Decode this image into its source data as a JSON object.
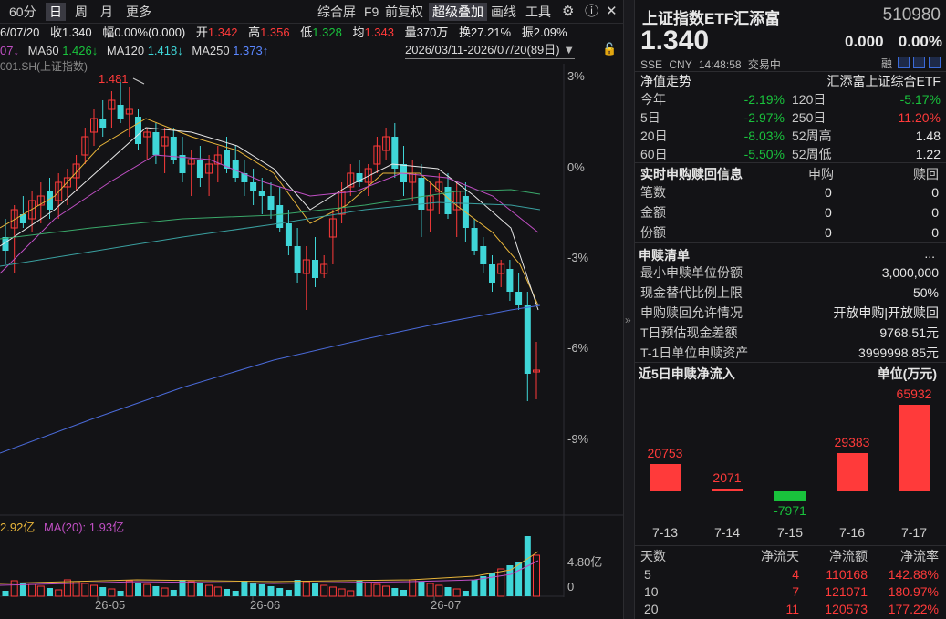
{
  "toolbar": {
    "items": [
      "60分",
      "日",
      "周",
      "月",
      "更多"
    ],
    "right_items": [
      "综合屏",
      "F9",
      "前复权",
      "超级叠加",
      "画线",
      "工具"
    ]
  },
  "info": {
    "date": "6/07/20",
    "close_label": "收",
    "close": "1.340",
    "change_label": "幅",
    "change": "0.00%(0.000)",
    "open_label": "开",
    "open": "1.342",
    "high_label": "高",
    "high": "1.356",
    "low_label": "低",
    "low": "1.328",
    "avg_label": "均",
    "avg": "1.343",
    "volume_label": "量",
    "volume": "370万",
    "turnover_label": "换",
    "turnover": "27.21%",
    "amplitude_label": "振",
    "amplitude": "2.09%"
  },
  "ma": {
    "ma30": "07↓",
    "ma60_label": "MA60",
    "ma60": "1.426↓",
    "ma120_label": "MA120",
    "ma120": "1.418↓",
    "ma250_label": "MA250",
    "ma250": "1.373↑"
  },
  "overlay_index": "001.SH(上证指数)",
  "date_range": "2026/03/11-2026/07/20(89日)",
  "peak_label": "1.481",
  "pct_axis": [
    "3%",
    "0%",
    "-3%",
    "-6%",
    "-9%"
  ],
  "volume_info": {
    "vol": "2.92亿",
    "ma20_label": "MA(20):",
    "ma20": "1.93亿",
    "scale_top": "4.80亿",
    "scale_zero": "0"
  },
  "x_axis": [
    "26-05",
    "26-06",
    "26-07"
  ],
  "quote": {
    "name": "上证指数ETF汇添富",
    "code": "510980",
    "price": "1.340",
    "change": "0.000",
    "change_pct": "0.00%",
    "exchange": "SSE",
    "currency": "CNY",
    "time": "14:48:58",
    "status": "交易中",
    "margin_tag": "融"
  },
  "nav_trend": {
    "title": "净值走势",
    "fund_name": "汇添富上证综合ETF",
    "rows": [
      {
        "l1": "今年",
        "v1": "-2.19%",
        "l2": "120日",
        "v2": "-5.17%"
      },
      {
        "l1": "5日",
        "v1": "-2.97%",
        "l2": "250日",
        "v2": "11.20%"
      },
      {
        "l1": "20日",
        "v1": "-8.03%",
        "l2": "52周高",
        "v2": "1.48"
      },
      {
        "l1": "60日",
        "v1": "-5.50%",
        "l2": "52周低",
        "v2": "1.22"
      }
    ]
  },
  "realtime": {
    "title": "实时申购赎回信息",
    "col1": "申购",
    "col2": "赎回",
    "rows": [
      {
        "label": "笔数",
        "sub": "0",
        "red": "0"
      },
      {
        "label": "金额",
        "sub": "0",
        "red": "0"
      },
      {
        "label": "份额",
        "sub": "0",
        "red": "0"
      }
    ]
  },
  "list": {
    "title": "申赎清单",
    "more": "...",
    "rows": [
      {
        "label": "最小申赎单位份额",
        "value": "3,000,000"
      },
      {
        "label": "现金替代比例上限",
        "value": "50%"
      },
      {
        "label": "申购赎回允许情况",
        "value": "开放申购|开放赎回"
      },
      {
        "label": "T日预估现金差额",
        "value": "9768.51元"
      },
      {
        "label": "T-1日单位申赎资产",
        "value": "3999998.85元"
      }
    ]
  },
  "flow": {
    "title": "近5日申赎净流入",
    "unit": "单位(万元)",
    "dates": [
      "7-13",
      "7-14",
      "7-15",
      "7-16",
      "7-17"
    ],
    "values": [
      20753,
      2071,
      -7971,
      29383,
      65932
    ]
  },
  "flow_table": {
    "headers": [
      "天数",
      "净流天",
      "净流额",
      "净流率"
    ],
    "rows": [
      {
        "days": "5",
        "flow_days": "4",
        "amount": "110168",
        "rate": "142.88%"
      },
      {
        "days": "10",
        "flow_days": "7",
        "amount": "121071",
        "rate": "180.97%"
      },
      {
        "days": "20",
        "flow_days": "11",
        "amount": "120573",
        "rate": "177.22%"
      }
    ]
  },
  "colors": {
    "up": "#ff3a3a",
    "down": "#19c23c",
    "candle_down": "#3fd6d8",
    "ma_yellow": "#e8b53a",
    "ma_magenta": "#c04fc4",
    "ma_green": "#3aa86a",
    "ma_blue": "#4a6ad8",
    "ma_teal": "#3aa0a0"
  }
}
